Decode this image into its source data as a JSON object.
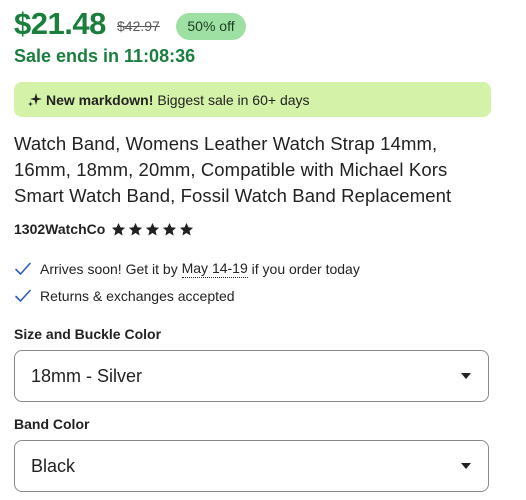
{
  "pricing": {
    "current_price": "$21.48",
    "original_price": "$42.97",
    "discount_badge": "50% off",
    "sale_ends": "Sale ends in 11:08:36"
  },
  "markdown_banner": {
    "icon": "sparkle-icon",
    "bold_text": "New markdown!",
    "text": "Biggest sale in 60+ days"
  },
  "product": {
    "title": "Watch Band, Womens Leather Watch Strap 14mm, 16mm, 18mm, 20mm, Compatible with Michael Kors Smart Watch Band, Fossil Watch Band Replacement",
    "shop_name": "1302WatchCo",
    "rating_stars": 5
  },
  "delivery": {
    "arrives_prefix": "Arrives soon! Get it by",
    "arrives_date": "May 14-19",
    "arrives_suffix": "if you order today",
    "returns": "Returns & exchanges accepted"
  },
  "options": {
    "size_label": "Size and Buckle Color",
    "size_value": "18mm - Silver",
    "color_label": "Band Color",
    "color_value": "Black"
  },
  "colors": {
    "price_green": "#1a7f3c",
    "badge_bg": "#9ee0a4",
    "banner_bg": "#d4f2a8",
    "check_blue": "#2f5dbb"
  }
}
